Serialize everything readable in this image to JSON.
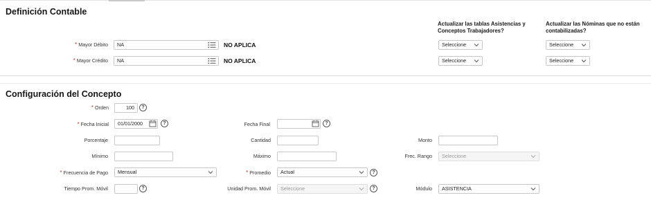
{
  "definicion": {
    "title": "Definición Contable",
    "col_asistencias": "Actualizar las tablas Asistencias y Conceptos Trabajadores?",
    "col_nominas": "Actualizar las Nóminas que no están contabilizadas?",
    "mayor_debito": {
      "label": "Mayor Débito",
      "value": "NA",
      "desc": "NO APLICA"
    },
    "mayor_credito": {
      "label": "Mayor Crédito",
      "value": "NA",
      "desc": "NO APLICA"
    },
    "select_placeholder": "Seleccione"
  },
  "configuracion": {
    "title": "Configuración del Concepto",
    "orden": {
      "label": "Orden",
      "value": "100"
    },
    "fecha_inicial": {
      "label": "Fecha Inicial",
      "value": "01/01/2000"
    },
    "fecha_final": {
      "label": "Fecha Final",
      "value": ""
    },
    "porcentaje": {
      "label": "Porcentaje",
      "value": ""
    },
    "cantidad": {
      "label": "Cantidad",
      "value": ""
    },
    "monto": {
      "label": "Monto",
      "value": ""
    },
    "minimo": {
      "label": "Mínimo",
      "value": ""
    },
    "maximo": {
      "label": "Máximo",
      "value": ""
    },
    "frec_rango": {
      "label": "Frec. Rango",
      "value": "Seleccione"
    },
    "frecuencia_pago": {
      "label": "Frecuencia de Pago",
      "value": "Mensual"
    },
    "promedio": {
      "label": "Promedio",
      "value": "Actual"
    },
    "tiempo_prom_movil": {
      "label": "Tiempo Prom. Móvil",
      "value": ""
    },
    "unidad_prom_movil": {
      "label": "Unidad Prom. Móvil",
      "value": "Seleccione"
    },
    "modulo": {
      "label": "Módulo",
      "value": "ASISTENCIA"
    }
  },
  "icons": {
    "help_glyph": "?",
    "required_glyph": "*"
  }
}
